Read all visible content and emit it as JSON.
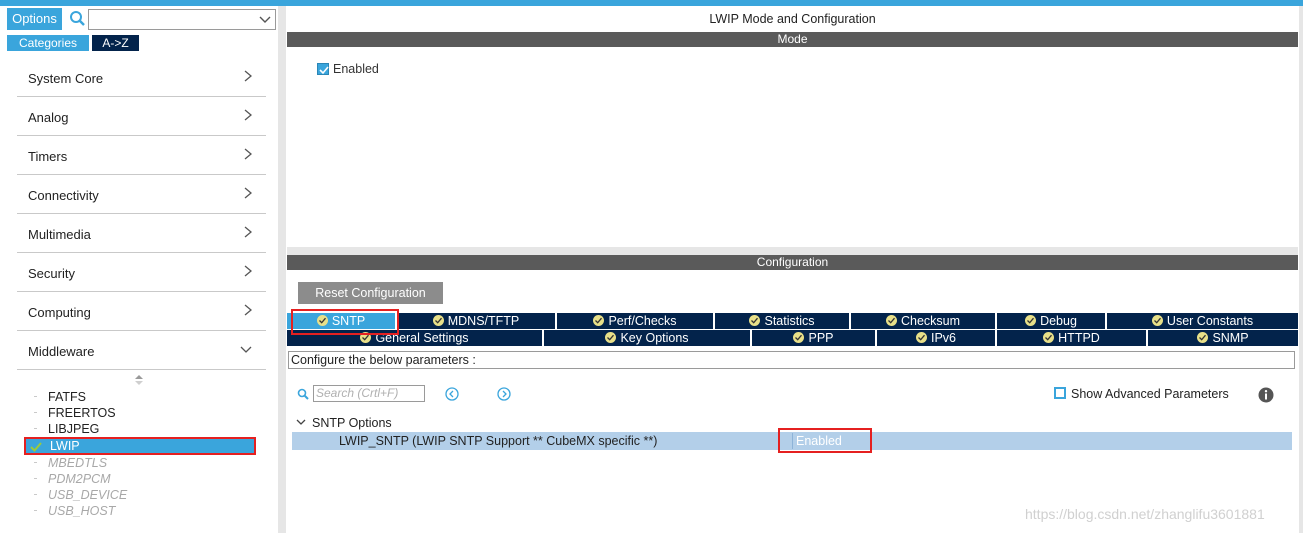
{
  "sidebar": {
    "options_label": "Options",
    "search_value": "",
    "tabs": {
      "categories": "Categories",
      "az": "A->Z"
    },
    "categories": [
      {
        "label": "System Core"
      },
      {
        "label": "Analog"
      },
      {
        "label": "Timers"
      },
      {
        "label": "Connectivity"
      },
      {
        "label": "Multimedia"
      },
      {
        "label": "Security"
      },
      {
        "label": "Computing"
      },
      {
        "label": "Middleware"
      }
    ],
    "middleware_items": [
      {
        "label": "FATFS"
      },
      {
        "label": "FREERTOS"
      },
      {
        "label": "LIBJPEG"
      },
      {
        "label": "LWIP"
      },
      {
        "label": "MBEDTLS"
      },
      {
        "label": "PDM2PCM"
      },
      {
        "label": "USB_DEVICE"
      },
      {
        "label": "USB_HOST"
      }
    ]
  },
  "main": {
    "title": "LWIP Mode and Configuration",
    "mode_header": "Mode",
    "mode_enabled_label": "Enabled",
    "config_header": "Configuration",
    "reset_label": "Reset Configuration",
    "tabs_row1": [
      {
        "label": "SNTP"
      },
      {
        "label": "MDNS/TFTP"
      },
      {
        "label": "Perf/Checks"
      },
      {
        "label": "Statistics"
      },
      {
        "label": "Checksum"
      },
      {
        "label": "Debug"
      },
      {
        "label": "User Constants"
      }
    ],
    "tabs_row2": [
      {
        "label": "General Settings"
      },
      {
        "label": "Key Options"
      },
      {
        "label": "PPP"
      },
      {
        "label": "IPv6"
      },
      {
        "label": "HTTPD"
      },
      {
        "label": "SNMP"
      }
    ],
    "configure_hint": "Configure the below parameters :",
    "search_placeholder": "Search (Crtl+F)",
    "show_advanced_label": "Show Advanced Parameters",
    "group_label": "SNTP Options",
    "param_name": "LWIP_SNTP (LWIP SNTP Support ** CubeMX specific **)",
    "param_value": "Enabled"
  },
  "watermark": "https://blog.csdn.net/zhanglifu3601881",
  "colors": {
    "accent": "#3aa5dc",
    "tab_dark": "#03234b",
    "highlight": "#e52020",
    "section_bar": "#5a5a5a",
    "selected_row": "#b3cfe9"
  }
}
